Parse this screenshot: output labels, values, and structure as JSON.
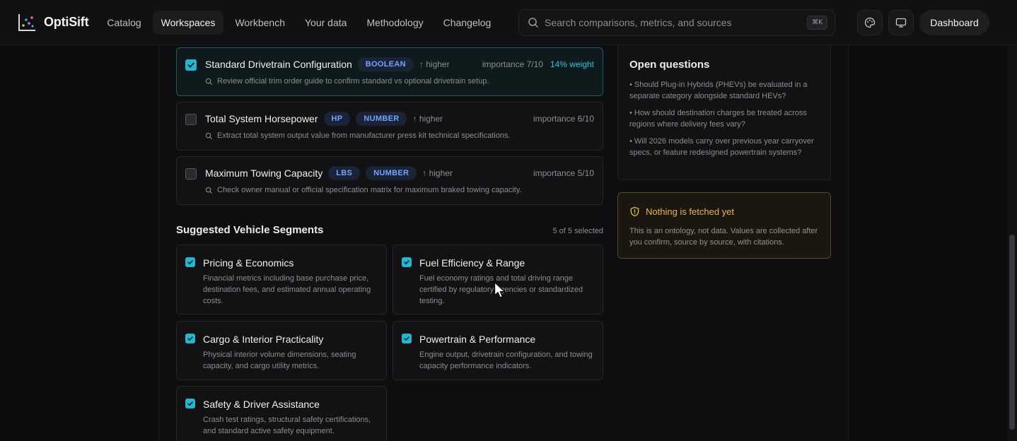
{
  "app": {
    "name": "OptiSift"
  },
  "nav": {
    "items": [
      "Catalog",
      "Workspaces",
      "Workbench",
      "Your data",
      "Methodology",
      "Changelog"
    ],
    "active": "Workspaces"
  },
  "search": {
    "placeholder": "Search comparisons, metrics, and sources",
    "shortcut": "⌘K"
  },
  "header": {
    "dashboard_label": "Dashboard",
    "theme_icon": "palette-icon",
    "display_icon": "monitor-icon"
  },
  "metrics": [
    {
      "name": "Standard Drivetrain Configuration",
      "tags": [
        "BOOLEAN"
      ],
      "direction": "↑ higher",
      "importance": "importance 7/10",
      "weight": "14% weight",
      "hint": "Review official trim order guide to confirm standard vs optional drivetrain setup.",
      "checked": true
    },
    {
      "name": "Total System Horsepower",
      "tags": [
        "HP",
        "NUMBER"
      ],
      "direction": "↑ higher",
      "importance": "importance 6/10",
      "weight": "",
      "hint": "Extract total system output value from manufacturer press kit technical specifications.",
      "checked": false
    },
    {
      "name": "Maximum Towing Capacity",
      "tags": [
        "LBS",
        "NUMBER"
      ],
      "direction": "↑ higher",
      "importance": "importance 5/10",
      "weight": "",
      "hint": "Check owner manual or official specification matrix for maximum braked towing capacity.",
      "checked": false
    }
  ],
  "segments": {
    "title": "Suggested Vehicle Segments",
    "count": "5 of 5 selected",
    "items": [
      {
        "name": "Pricing & Economics",
        "desc": "Financial metrics including base purchase price, destination fees, and estimated annual operating costs.",
        "checked": true
      },
      {
        "name": "Fuel Efficiency & Range",
        "desc": "Fuel economy ratings and total driving range certified by regulatory agencies or standardized testing.",
        "checked": true
      },
      {
        "name": "Cargo & Interior Practicality",
        "desc": "Physical interior volume dimensions, seating capacity, and cargo utility metrics.",
        "checked": true
      },
      {
        "name": "Powertrain & Performance",
        "desc": "Engine output, drivetrain configuration, and towing capacity performance indicators.",
        "checked": true
      },
      {
        "name": "Safety & Driver Assistance",
        "desc": "Crash test ratings, structural safety certifications, and standard active safety equipment.",
        "checked": true
      }
    ]
  },
  "questions": {
    "title": "Open questions",
    "items": [
      "• Should Plug-in Hybrids (PHEVs) be evaluated in a separate category alongside standard HEVs?",
      "• How should destination charges be treated across regions where delivery fees vary?",
      "• Will 2026 models carry over previous year carryover specs, or feature redesigned powertrain systems?"
    ]
  },
  "notice": {
    "title": "Nothing is fetched yet",
    "body": "This is an ontology, not data. Values are collected after you confirm, source by source, with citations.",
    "icon": "shield-alert-icon"
  },
  "colors": {
    "accent": "#25b6cc",
    "pill_text": "#6fa4ff",
    "warning": "#e8b64a"
  }
}
